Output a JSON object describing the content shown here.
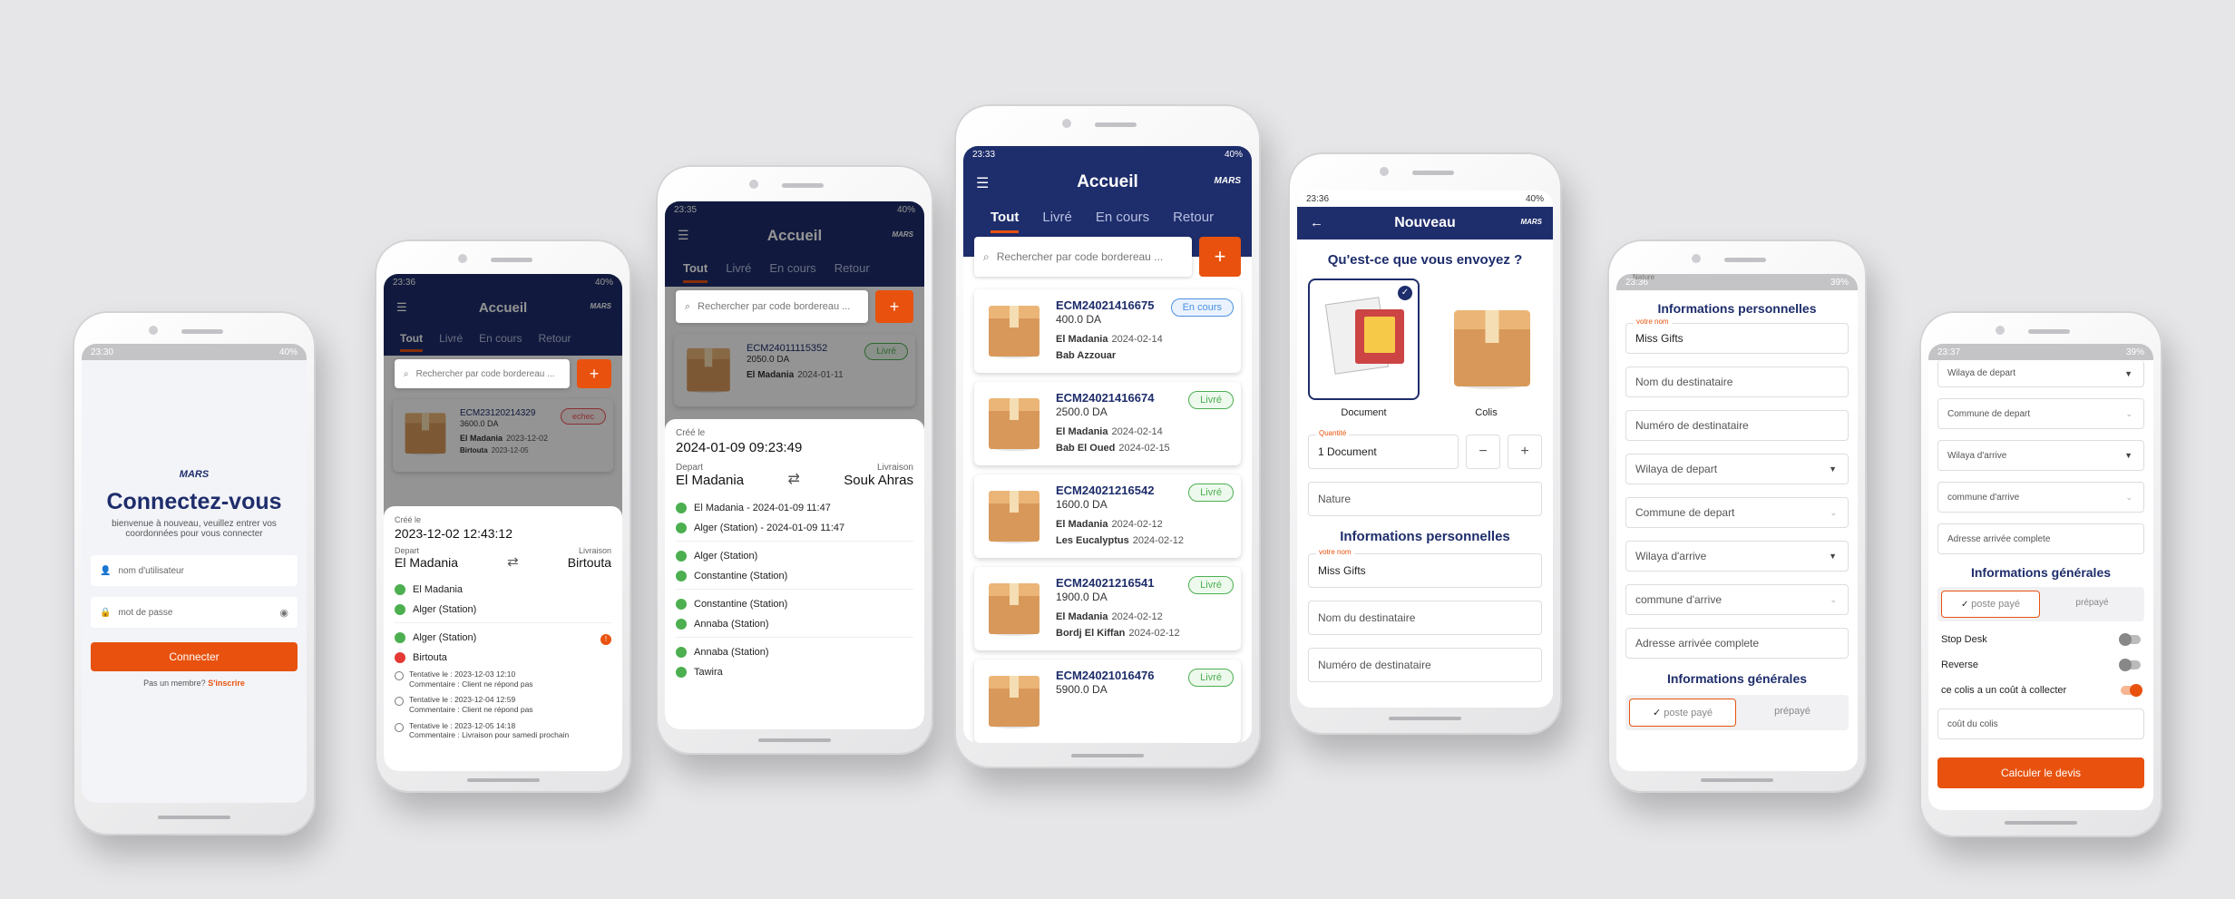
{
  "brand": {
    "logo": "MARS",
    "accent": "#e8520e",
    "primary": "#1e2d6b"
  },
  "login": {
    "time": "23:30",
    "battery": "40%",
    "title": "Connectez-vous",
    "subtitle": "bienvenue à nouveau, veuillez entrer vos coordonnées pour vous connecter",
    "username_placeholder": "nom d'utilisateur",
    "password_placeholder": "mot de passe",
    "button": "Connecter",
    "not_member": "Pas un membre?",
    "signup": "S'inscrire"
  },
  "home_tabs": [
    "Tout",
    "Livré",
    "En cours",
    "Retour"
  ],
  "home_title": "Accueil",
  "search_placeholder": "Rechercher par code bordereau ...",
  "detail1": {
    "time": "23:36",
    "battery": "40%",
    "card_id": "ECM23120214329",
    "card_amount": "3600.0 DA",
    "card_from": "El Madania",
    "card_from_date": "2023-12-02",
    "card_to": "Birtouta",
    "card_to_date": "2023-12-05",
    "badge": "echec",
    "created_label": "Créé le",
    "created": "2023-12-02 12:43:12",
    "depart_label": "Depart",
    "depart": "El Madania",
    "livraison_label": "Livraison",
    "livraison": "Birtouta",
    "steps": [
      "El Madania",
      "Alger (Station)",
      "Alger (Station)",
      "Birtouta"
    ],
    "alert": "!",
    "attempts": [
      {
        "l1": "Tentative le : 2023-12-03 12:10",
        "l2": "Commentaire : Client ne répond pas"
      },
      {
        "l1": "Tentative le : 2023-12-04 12:59",
        "l2": "Commentaire : Client ne répond pas"
      },
      {
        "l1": "Tentative le : 2023-12-05 14:18",
        "l2": "Commentaire : Livraison pour samedi prochain"
      }
    ]
  },
  "detail2": {
    "time": "23:35",
    "battery": "40%",
    "card_id": "ECM24011115352",
    "card_amount": "2050.0 DA",
    "card_from": "El Madania",
    "card_from_date": "2024-01-11",
    "badge": "Livré",
    "created_label": "Créé le",
    "created": "2024-01-09 09:23:49",
    "depart_label": "Depart",
    "depart": "El Madania",
    "livraison_label": "Livraison",
    "livraison": "Souk Ahras",
    "steps": [
      "El Madania - 2024-01-09 11:47",
      "Alger (Station) - 2024-01-09 11:47",
      "Alger (Station)",
      "Constantine (Station)",
      "Constantine (Station)",
      "Annaba (Station)",
      "Annaba (Station)",
      "Tawira"
    ]
  },
  "home": {
    "time": "23:33",
    "battery": "40%",
    "cards": [
      {
        "id": "ECM24021416675",
        "amount": "400.0 DA",
        "from": "El Madania",
        "from_date": "2024-02-14",
        "to": "Bab Azzouar",
        "to_date": "",
        "badge": "En cours",
        "kind": "blue"
      },
      {
        "id": "ECM24021416674",
        "amount": "2500.0 DA",
        "from": "El Madania",
        "from_date": "2024-02-14",
        "to": "Bab El Oued",
        "to_date": "2024-02-15",
        "badge": "Livré",
        "kind": "green"
      },
      {
        "id": "ECM24021216542",
        "amount": "1600.0 DA",
        "from": "El Madania",
        "from_date": "2024-02-12",
        "to": "Les Eucalyptus",
        "to_date": "2024-02-12",
        "badge": "Livré",
        "kind": "green"
      },
      {
        "id": "ECM24021216541",
        "amount": "1900.0 DA",
        "from": "El Madania",
        "from_date": "2024-02-12",
        "to": "Bordj El Kiffan",
        "to_date": "2024-02-12",
        "badge": "Livré",
        "kind": "green"
      },
      {
        "id": "ECM24021016476",
        "amount": "5900.0 DA",
        "from": "",
        "from_date": "",
        "to": "",
        "to_date": "",
        "badge": "Livré",
        "kind": "green"
      }
    ]
  },
  "nouveau": {
    "time": "23:36",
    "battery": "40%",
    "title": "Nouveau",
    "question": "Qu'est-ce que vous envoyez ?",
    "opt1": "Document",
    "opt2": "Colis",
    "qty_label": "Quantité",
    "qty_value": "1 Document",
    "minus": "−",
    "plus": "+",
    "nature": "Nature",
    "info_title": "Informations personnelles",
    "name_label": "votre nom",
    "name_value": "Miss Gifts",
    "dest_name": "Nom du destinataire",
    "dest_num": "Numéro de destinataire"
  },
  "form1": {
    "time": "23:36",
    "battery": "39%",
    "top_label": "Nature",
    "info_title": "Informations personnelles",
    "name_label": "votre nom",
    "name_value": "Miss Gifts",
    "fields": [
      "Nom du destinataire",
      "Numéro de destinataire",
      "Wilaya de depart",
      "Commune de depart",
      "Wilaya d'arrive",
      "commune d'arrive",
      "Adresse arrivée complete"
    ],
    "gen_title": "Informations générales",
    "seg1": "poste payé",
    "seg2": "prépayé"
  },
  "form2": {
    "time": "23:37",
    "battery": "39%",
    "fields": [
      "Wilaya de depart",
      "Commune de depart",
      "Wilaya d'arrive",
      "commune d'arrive",
      "Adresse arrivée complete"
    ],
    "gen_title": "Informations générales",
    "seg1": "poste payé",
    "seg2": "prépayé",
    "toggles": [
      "Stop Desk",
      "Reverse",
      "ce colis a un coût à collecter"
    ],
    "cost": "coût du colis",
    "button": "Calculer le devis"
  }
}
